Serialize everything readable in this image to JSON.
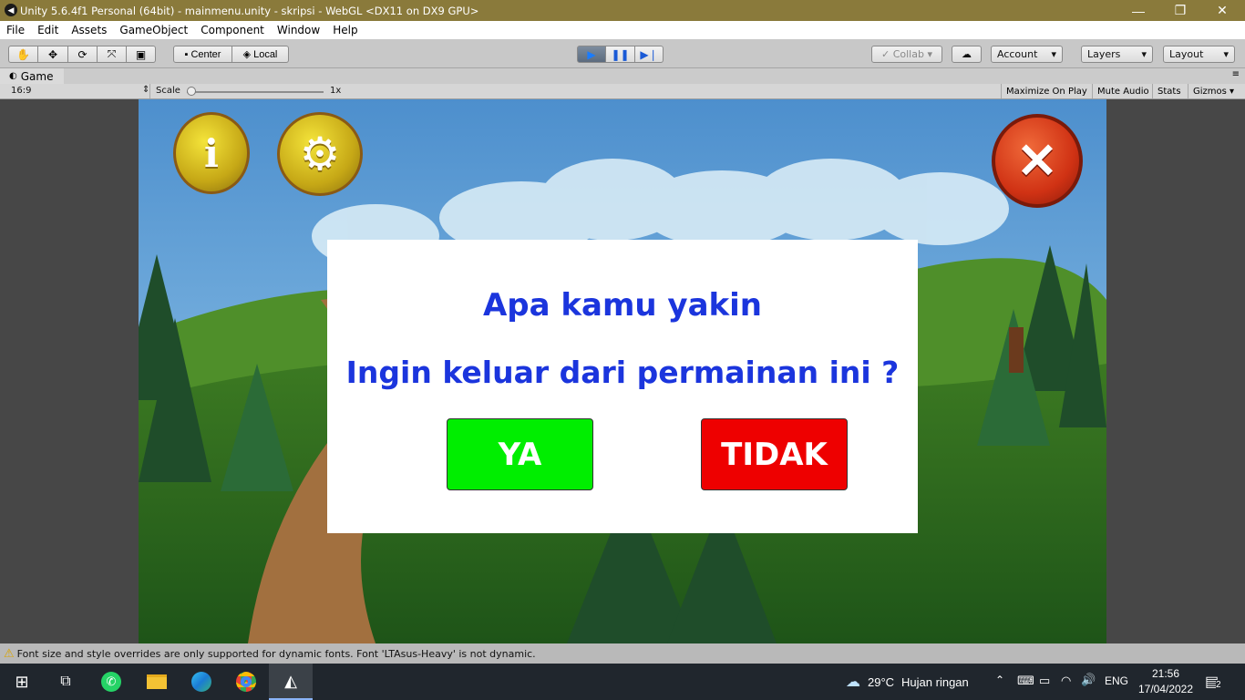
{
  "window": {
    "title": "Unity 5.6.4f1 Personal (64bit) - mainmenu.unity - skripsi - WebGL <DX11 on DX9 GPU>",
    "minimize": "—",
    "maximize": "❐",
    "close": "✕"
  },
  "menu": [
    "File",
    "Edit",
    "Assets",
    "GameObject",
    "Component",
    "Window",
    "Help"
  ],
  "toolbar": {
    "center_label": "Center",
    "local_label": "Local",
    "collab_label": "Collab",
    "account_label": "Account",
    "layers_label": "Layers",
    "layout_label": "Layout"
  },
  "game_tab": {
    "label": "Game",
    "aspect": "16:9",
    "scale_label": "Scale",
    "scale_value": "1x",
    "scale_level": 0.0,
    "maximize_on_play": "Maximize On Play",
    "mute_audio": "Mute Audio",
    "stats": "Stats",
    "gizmos": "Gizmos"
  },
  "dialog": {
    "line1": "Apa kamu yakin",
    "line2": "Ingin keluar dari permainan ini ?",
    "yes_label": "YA",
    "no_label": "TIDAK",
    "yes_color": "#00ee00",
    "no_color": "#ee0000"
  },
  "status": {
    "message": "Font size and style overrides are only supported for dynamic fonts. Font 'LTAsus-Heavy' is not dynamic."
  },
  "taskbar": {
    "weather_temp": "29°C",
    "weather_text": "Hujan ringan",
    "language": "ENG",
    "time": "21:56",
    "date": "17/04/2022",
    "notifications": "2"
  },
  "colors": {
    "titlebar": "#8a7a3b",
    "dialog_text": "#1b35dd"
  }
}
